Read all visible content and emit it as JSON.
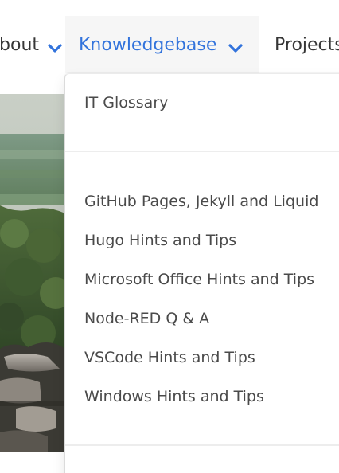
{
  "nav": {
    "about_label": "About",
    "knowledgebase_label": "Knowledgebase",
    "projects_label": "Projects"
  },
  "dropdown": {
    "top_item": "IT Glossary",
    "items": [
      "GitHub Pages, Jekyll and Liquid",
      "Hugo Hints and Tips",
      "Microsoft Office Hints and Tips",
      "Node-RED Q & A",
      "VSCode Hints and Tips",
      "Windows Hints and Tips"
    ]
  },
  "icons": {
    "chevron": "chevron-down-icon"
  },
  "colors": {
    "link": "#3273dc",
    "active_bg": "#f6f6f6",
    "text": "#4a4a4a",
    "divider": "#ededed"
  }
}
